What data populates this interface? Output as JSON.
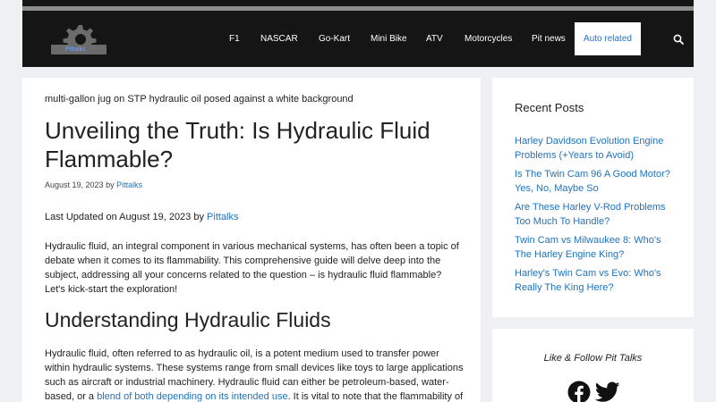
{
  "brand": {
    "logo_text": "Pittalks"
  },
  "nav": {
    "items": [
      {
        "label": "F1"
      },
      {
        "label": "NASCAR"
      },
      {
        "label": "Go-Kart"
      },
      {
        "label": "Mini Bike"
      },
      {
        "label": "ATV"
      },
      {
        "label": "Motorcycles"
      },
      {
        "label": "Pit news"
      },
      {
        "label": "Auto related"
      }
    ],
    "active_index": 7
  },
  "article": {
    "image_caption": "multi-gallon jug on STP hydraulic oil posed against a white background",
    "title": "Unveiling the Truth: Is Hydraulic Fluid Flammable?",
    "date": "August 19, 2023",
    "by": "by",
    "author": "Pittalks",
    "updated_prefix": "Last Updated on August 19, 2023 by",
    "updated_author": "Pittalks",
    "intro": "Hydraulic fluid, an integral component in various mechanical systems, has often been a topic of debate when it comes to its flammability. This comprehensive guide will delve deep into the subject, addressing all your concerns related to the question – is hydraulic fluid flammable? Let's kick-start the exploration!",
    "h2": "Understanding Hydraulic Fluids",
    "para2_start": "Hydraulic fluid, often referred to as hydraulic oil, is a potent medium used to transfer power within hydraulic systems. These systems range from small devices like toys to large applications such as aircraft or industrial machinery. Hydraulic fluid can either be petroleum-based, water-based, or a",
    "para2_link": "blend of both depending on its intended use",
    "para2_end": ". It is vital to note that the flammability of hydraulic fluid"
  },
  "sidebar": {
    "recent_title": "Recent Posts",
    "recent_posts": [
      {
        "title": "Harley Davidson Evolution Engine Problems (+Years to Avoid)"
      },
      {
        "title": "Is The Twin Cam 96 A Good Motor? Yes, No, Maybe So"
      },
      {
        "title": "Are These Harley V-Rod Problems Too Much To Handle?"
      },
      {
        "title": "Twin Cam vs Milwaukee 8: Who's The Harley Engine King?"
      },
      {
        "title": "Harley's Twin Cam vs Evo: Who's Really The King Here?"
      }
    ],
    "follow_text": "Like & Follow Pit Talks",
    "social_icons": [
      "facebook-icon",
      "twitter-icon"
    ]
  },
  "colors": {
    "header_bg": "#151515",
    "link": "#1e73be",
    "accent": "#1d74d8",
    "page_bg": "#eef0f3"
  }
}
